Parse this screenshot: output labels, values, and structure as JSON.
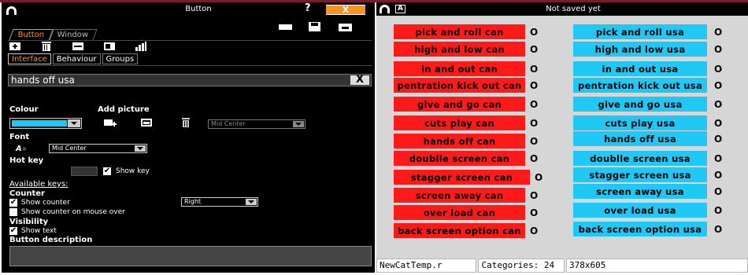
{
  "editor": {
    "title": "Button",
    "help": "?",
    "close": "X",
    "main_tabs": [
      {
        "label": "Button"
      },
      {
        "label": "Window"
      }
    ],
    "sub_tabs": [
      {
        "label": "Interface"
      },
      {
        "label": "Behaviour"
      },
      {
        "label": "Groups"
      }
    ],
    "name_value": "hands off usa",
    "clear_label": "X",
    "colour_label": "Colour",
    "add_picture_label": "Add picture",
    "picture_position": "Mid Center",
    "font_label": "Font",
    "font_position": "Mid Center",
    "hotkey_label": "Hot key",
    "show_key_label": "Show key",
    "available_keys_label": "Available keys:",
    "counter_label": "Counter",
    "show_counter_label": "Show counter",
    "counter_position": "Right",
    "show_counter_mouse_label": "Show counter on mouse over",
    "visibility_label": "Visibility",
    "show_text_label": "Show text",
    "description_label": "Button description",
    "colour_value": "#1fc8f5",
    "accent": "#f7941d"
  },
  "category": {
    "title": "Not saved yet",
    "a_button": "A",
    "count_symbol": "O",
    "red_buttons": [
      "pick and roll can",
      "high and low can",
      "in and out can",
      "pentration kick out can",
      "give and go can",
      "cuts play can",
      "hands off can",
      "doublle screen can",
      "stagger screen can",
      "screen away can",
      "over load can",
      "back screen option can"
    ],
    "blue_buttons": [
      "pick and roll usa",
      "high and low usa",
      "in and out usa",
      "pentration kick out usa",
      "give and go usa",
      "cuts play usa",
      "hands off usa",
      "doublle screen usa",
      "stagger screen usa",
      "screen away usa",
      "over load usa",
      "back screen option usa"
    ],
    "red_color": "#ff1a1a",
    "blue_color": "#1fc8f5",
    "status": {
      "file": "NewCatTemp.r",
      "categories": "Categories: 24",
      "size": "378x605"
    }
  }
}
